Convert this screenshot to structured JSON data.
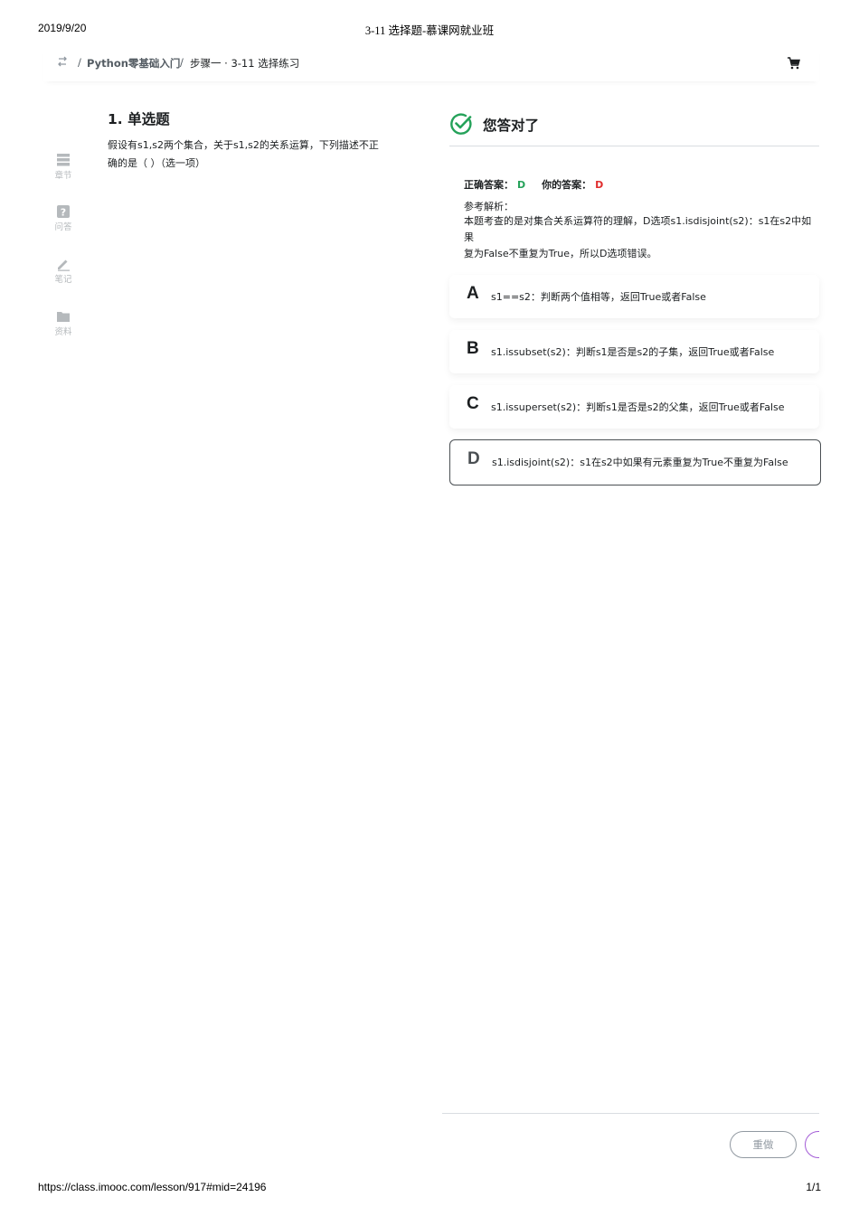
{
  "print_header": {
    "date": "2019/9/20",
    "title": "3-11 选择题-慕课网就业班"
  },
  "print_footer": {
    "url": "https://class.imooc.com/lesson/917#mid=24196",
    "page": "1/1"
  },
  "breadcrumb": {
    "separator": "/",
    "course": "Python零基础入门",
    "current": "步骤一 · 3-11 选择练习"
  },
  "sidebar": {
    "items": [
      {
        "label": "章节",
        "icon": "chapter-icon"
      },
      {
        "label": "问答",
        "icon": "question-icon"
      },
      {
        "label": "笔记",
        "icon": "pencil-icon"
      },
      {
        "label": "资料",
        "icon": "folder-icon"
      }
    ]
  },
  "question": {
    "title": "1. 单选题",
    "text": "假设有s1,s2两个集合，关于s1,s2的关系运算，下列描述不正确的是（   ）（选一项）"
  },
  "result": {
    "status": "您答对了",
    "correct_label": "正确答案：",
    "correct_value": "D",
    "your_label": "你的答案：",
    "your_value": "D",
    "explanation_label": "参考解析：",
    "explanation": "本题考查的是对集合关系运算符的理解，D选项s1.isdisjoint(s2)：s1在s2中如果\n复为False不重复为True，所以D选项错误。"
  },
  "options": [
    {
      "letter": "A",
      "text": "s1==s2：判断两个值相等，返回True或者False",
      "selected": false
    },
    {
      "letter": "B",
      "text": "s1.issubset(s2)：判断s1是否是s2的子集，返回True或者False",
      "selected": false
    },
    {
      "letter": "C",
      "text": "s1.issuperset(s2)：判断s1是否是s2的父集，返回True或者False",
      "selected": false
    },
    {
      "letter": "D",
      "text": "s1.isdisjoint(s2)：s1在s2中如果有元素重复为True不重复为False",
      "selected": true
    }
  ],
  "actions": {
    "redo_label": "重做"
  },
  "colors": {
    "correct": "#25a25a",
    "yours": "#e02d2d",
    "muted": "#b5b9bc",
    "next_border": "#a35cd6"
  }
}
